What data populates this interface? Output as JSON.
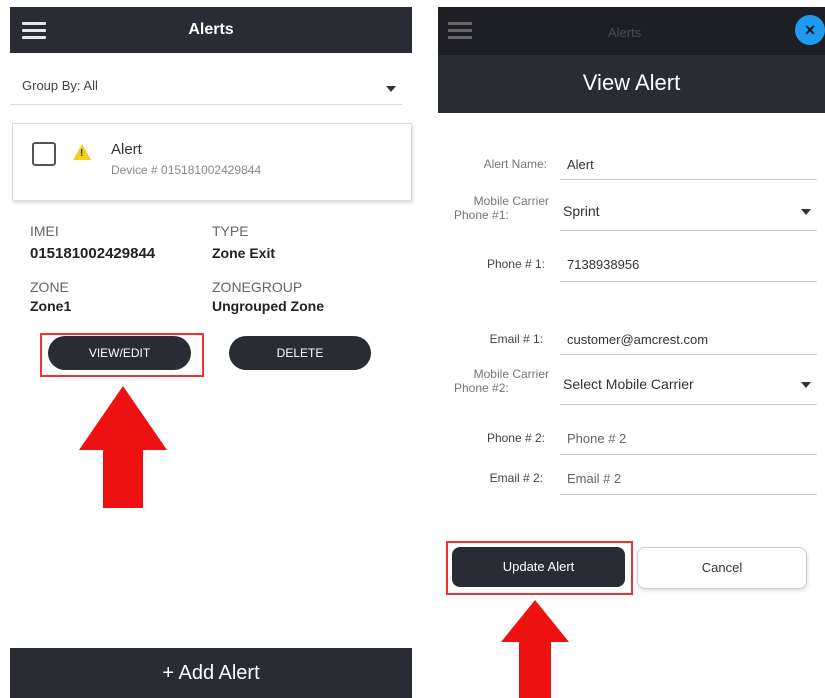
{
  "left": {
    "header_title": "Alerts",
    "group_by": "Group By: All",
    "alert_card": {
      "name": "Alert",
      "device": "Device # 015181002429844"
    },
    "details": {
      "imei_label": "IMEI",
      "imei_value": "015181002429844",
      "type_label": "TYPE",
      "type_value": "Zone Exit",
      "zone_label": "ZONE",
      "zone_value": "Zone1",
      "zonegroup_label": "ZONEGROUP",
      "zonegroup_value": "Ungrouped Zone"
    },
    "view_edit_label": "VIEW/EDIT",
    "delete_label": "DELETE",
    "add_alert_label": "+ Add Alert"
  },
  "right": {
    "background_title": "Alerts",
    "modal_title": "View Alert",
    "close_glyph": "×",
    "fields": {
      "alert_name_label": "Alert Name:",
      "alert_name_value": "Alert",
      "carrier1_label_l1": "Mobile Carrier",
      "carrier1_label_l2": "Phone #1:",
      "carrier1_value": "Sprint",
      "phone1_label": "Phone # 1:",
      "phone1_value": "7138938956",
      "email1_label": "Email # 1:",
      "email1_value": "customer@amcrest.com",
      "carrier2_label_l1": "Mobile Carrier",
      "carrier2_label_l2": "Phone #2:",
      "carrier2_value": "Select Mobile Carrier",
      "phone2_label": "Phone # 2:",
      "phone2_placeholder": "Phone # 2",
      "email2_label": "Email # 2:",
      "email2_placeholder": "Email # 2"
    },
    "update_label": "Update Alert",
    "cancel_label": "Cancel"
  },
  "colors": {
    "dark_bar": "#2a2c33",
    "highlight_red": "#ee1111",
    "warning_yellow": "#f2cf1d",
    "close_blue": "#1e9bf0"
  },
  "icons": [
    "hamburger-icon",
    "checkbox-icon",
    "warning-icon",
    "chevron-down-icon",
    "close-icon",
    "arrow-up-icon"
  ]
}
